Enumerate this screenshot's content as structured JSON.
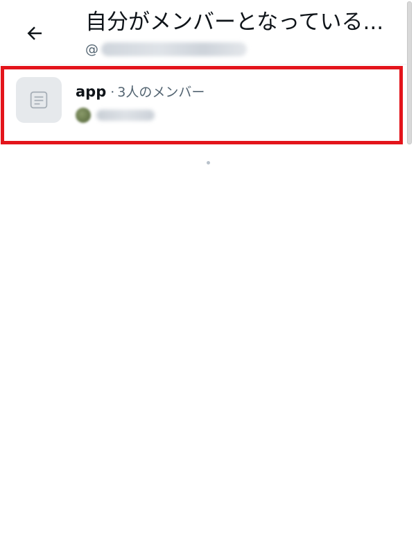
{
  "header": {
    "title": "自分がメンバーとなっている...",
    "handle_prefix": "@",
    "back_icon": "arrow-left-icon"
  },
  "lists": [
    {
      "name": "app",
      "separator": "·",
      "members": "3人のメンバー",
      "icon": "list-document-icon",
      "highlight_color": "#e3141b"
    }
  ],
  "colors": {
    "primary_text": "#0f1419",
    "secondary_text": "#536471",
    "highlight": "#e3141b"
  }
}
